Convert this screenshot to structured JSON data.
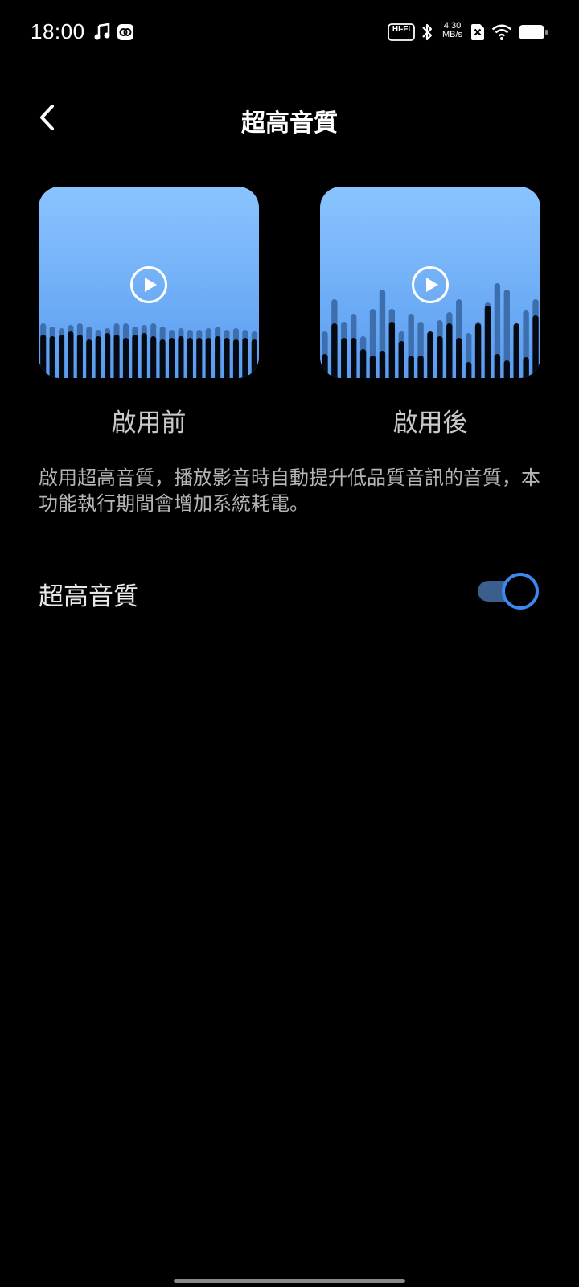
{
  "status_bar": {
    "time": "18:00",
    "hifi_badge": "HI-FI",
    "speed_value": "4.30",
    "speed_unit": "MB/s",
    "icons": [
      "music-note-icon",
      "app-badge-icon",
      "hifi-icon",
      "bluetooth-icon",
      "data-speed-icon",
      "no-sim-icon",
      "wifi-icon",
      "battery-icon"
    ]
  },
  "header": {
    "title": "超高音質",
    "back_icon": "back-arrow-icon"
  },
  "preview": {
    "before": {
      "caption": "啟用前",
      "icon": "play-icon"
    },
    "after": {
      "caption": "啟用後",
      "icon": "play-icon"
    }
  },
  "description": "啟用超高音質，播放影音時自動提升低品質音訊的音質，本功能執行期間會增加系統耗電。",
  "setting": {
    "label": "超高音質",
    "enabled": true
  },
  "colors": {
    "accent": "#3b88f0",
    "card_top": "#8ac4ff",
    "card_bottom": "#5a9cf0"
  }
}
